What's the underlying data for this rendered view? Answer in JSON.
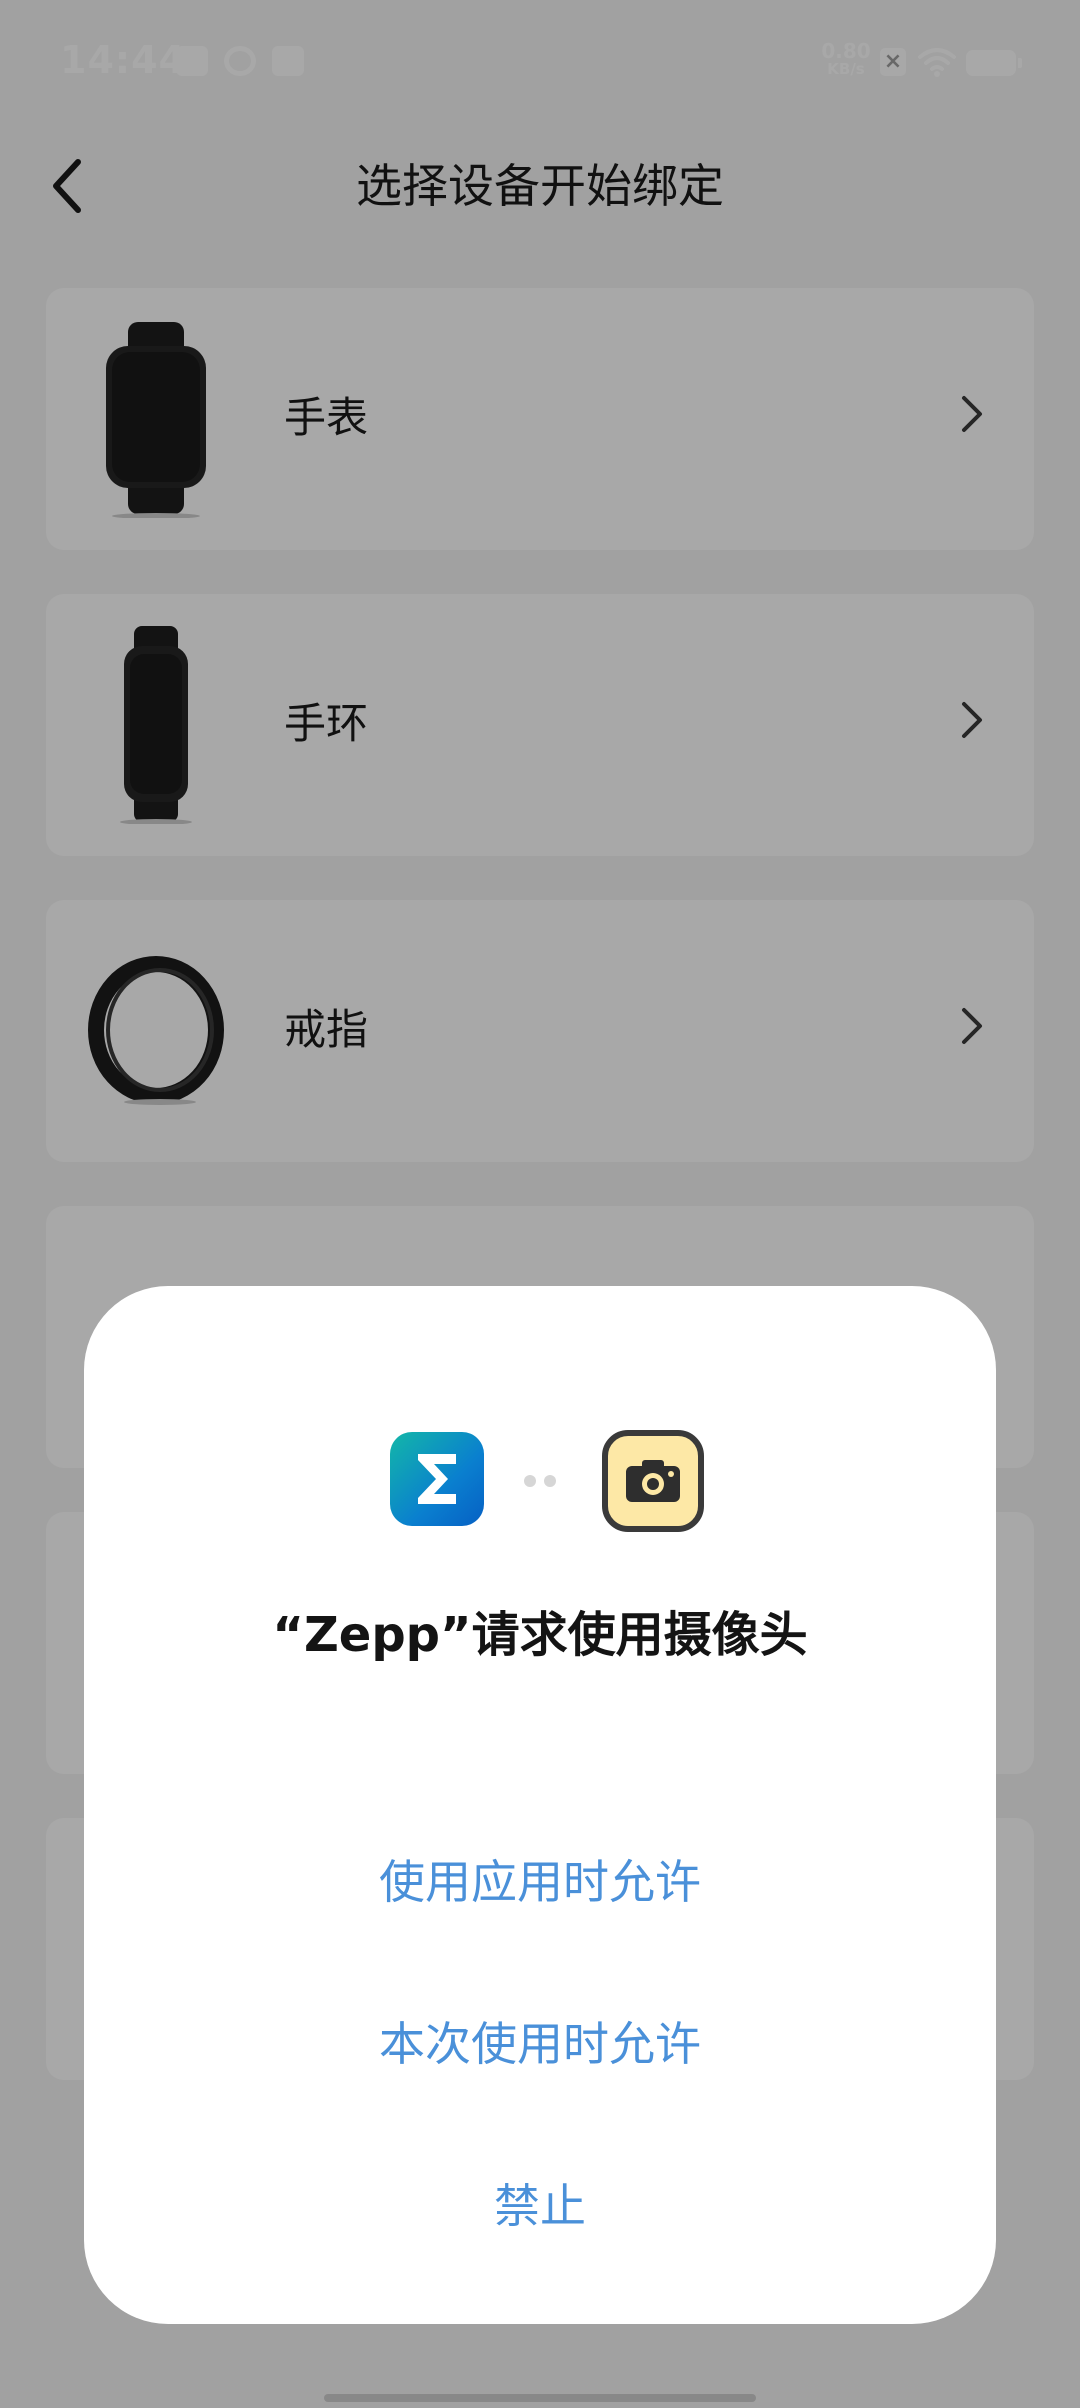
{
  "status_bar": {
    "time": "14:44",
    "net_speed_value": "0.80",
    "net_speed_unit": "KB/s",
    "icons": [
      "notification-icon",
      "app-icon",
      "message-icon",
      "sim-off-icon",
      "wifi-icon",
      "battery-icon"
    ]
  },
  "header": {
    "title": "选择设备开始绑定",
    "back_icon": "chevron-left-icon"
  },
  "devices": [
    {
      "label": "手表",
      "thumb": "watch-image"
    },
    {
      "label": "手环",
      "thumb": "band-image"
    },
    {
      "label": "戒指",
      "thumb": "ring-image"
    },
    {
      "label": "",
      "thumb": "device-image"
    },
    {
      "label": "",
      "thumb": ""
    },
    {
      "label": "",
      "thumb": ""
    }
  ],
  "dialog": {
    "title": "“Zepp”请求使用摄像头",
    "app_icon": "zepp-app-icon",
    "permission_icon": "camera-icon",
    "options": {
      "allow_while_using": "使用应用时允许",
      "allow_this_time": "本次使用时允许",
      "deny": "禁止"
    },
    "accent_color": "#4a90d9"
  }
}
